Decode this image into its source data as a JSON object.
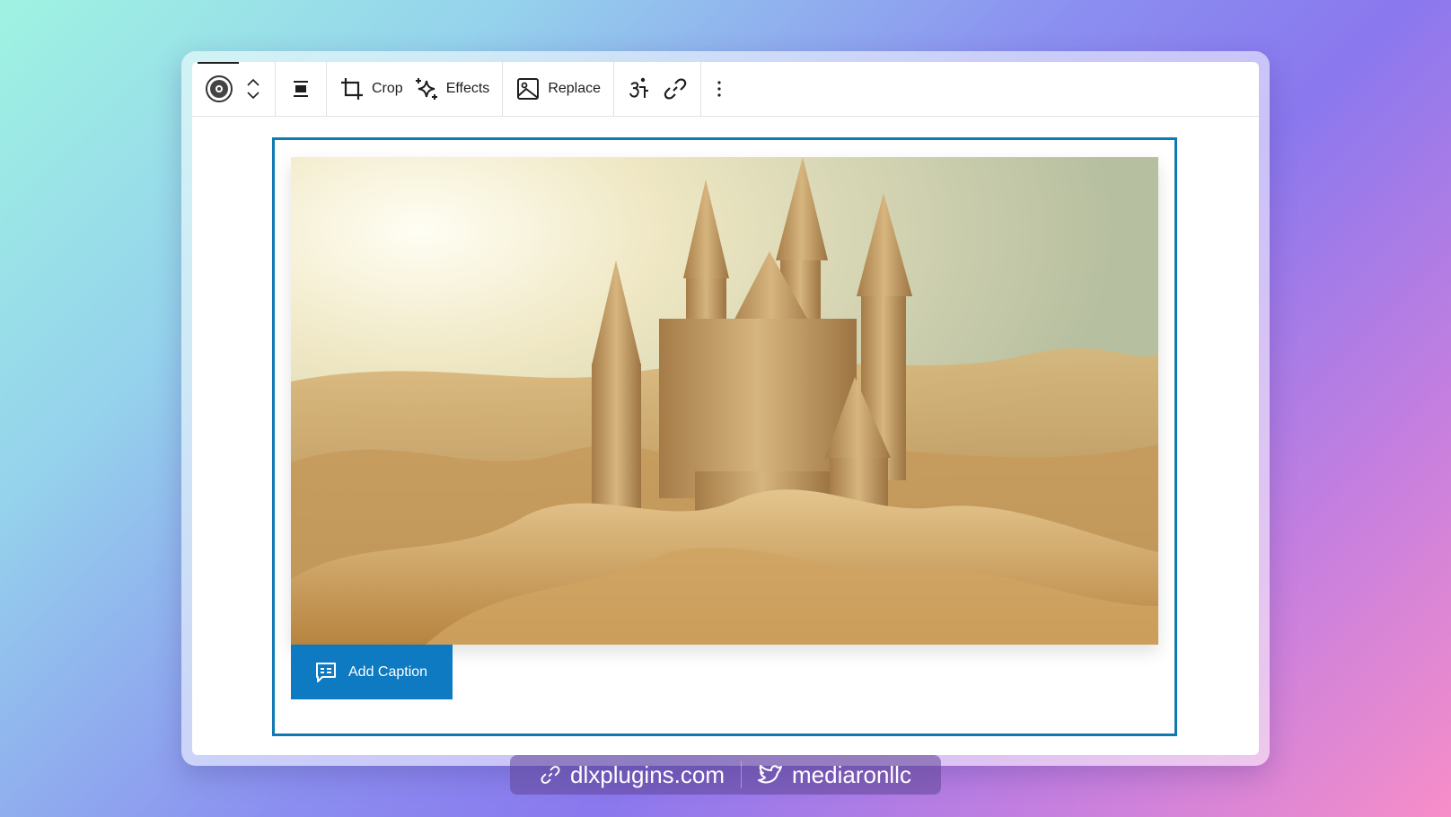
{
  "toolbar": {
    "block_icon": "media-block-icon",
    "move_up_label": "Move up",
    "move_down_label": "Move down",
    "align_icon": "align-center-icon",
    "crop_label": "Crop",
    "effects_label": "Effects",
    "replace_label": "Replace",
    "alt_text_icon": "accessibility-icon",
    "link_icon": "link-icon",
    "more_icon": "more-vertical-icon"
  },
  "image": {
    "alt": "Sandcastle with tall spires on sand dunes"
  },
  "caption_button": {
    "label": "Add Caption",
    "icon": "caption-icon"
  },
  "footer": {
    "website": "dlxplugins.com",
    "twitter": "mediaronllc"
  },
  "colors": {
    "accent": "#0f7ab1",
    "caption_bg": "#0d7ac1",
    "text": "#1e1e1e"
  }
}
